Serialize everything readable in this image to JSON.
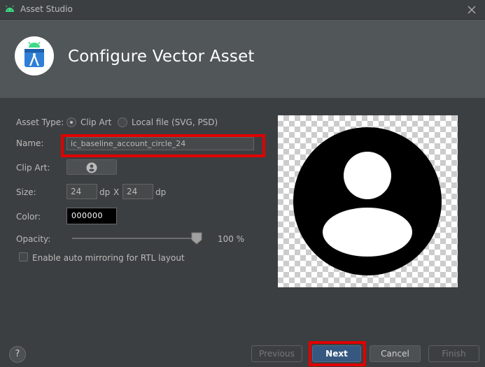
{
  "window": {
    "title": "Asset Studio",
    "icon": "android-icon",
    "close_icon": "close-icon"
  },
  "header": {
    "title": "Configure Vector Asset",
    "logo_icon": "android-studio-logo"
  },
  "form": {
    "asset_type": {
      "label": "Asset Type:",
      "options": [
        {
          "label": "Clip Art",
          "selected": true
        },
        {
          "label": "Local file (SVG, PSD)",
          "selected": false
        }
      ]
    },
    "name": {
      "label": "Name:",
      "value": "ic_baseline_account_circle_24"
    },
    "clip_art": {
      "label": "Clip Art:",
      "icon": "account-circle-icon"
    },
    "size": {
      "label": "Size:",
      "width": "24",
      "height": "24",
      "unit": "dp",
      "separator": "X"
    },
    "color": {
      "label": "Color:",
      "value": "000000"
    },
    "opacity": {
      "label": "Opacity:",
      "value": "100",
      "unit": "%",
      "fraction": 1.0
    },
    "mirroring": {
      "label": "Enable auto mirroring for RTL layout",
      "checked": false
    }
  },
  "preview": {
    "icon": "account-circle-icon",
    "background": "transparent-checkerboard"
  },
  "footer": {
    "help": "?",
    "previous": "Previous",
    "next": "Next",
    "cancel": "Cancel",
    "finish": "Finish"
  },
  "colors": {
    "dialog_bg": "#3c3f41",
    "header_bg": "#515658",
    "highlight": "#e00000",
    "primary_button": "#365880"
  }
}
